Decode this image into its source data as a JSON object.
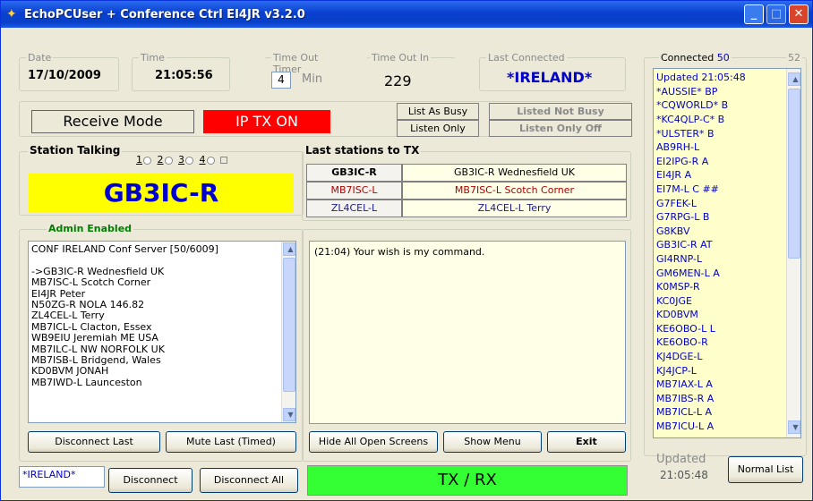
{
  "window": {
    "title": "EchoPCUser + Conference Ctrl   EI4JR  v3.2.0",
    "min_icon": "minimize-icon",
    "max_icon": "maximize-icon",
    "close_icon": "close-icon"
  },
  "date": {
    "label": "Date",
    "value": "17/10/2009"
  },
  "time": {
    "label": "Time",
    "value": "21:05:56"
  },
  "timeout": {
    "label": "Time Out Timer",
    "value": "4",
    "unit": "Min"
  },
  "timeoutin": {
    "label": "Time Out In",
    "value": "229"
  },
  "last_connected": {
    "label": "Last Connected",
    "value": "*IRELAND*"
  },
  "mode": {
    "receive": "Receive Mode",
    "iptx": "IP TX ON",
    "list_busy": "List As Busy",
    "listen_only": "Listen Only",
    "listed_not_busy": "Listed Not Busy",
    "listen_only_off": "Listen Only Off"
  },
  "station_talking": {
    "label": "Station Talking",
    "radios": [
      "1",
      "2",
      "3",
      "4"
    ],
    "value": "GB3IC-R"
  },
  "last_tx": {
    "label": "Last stations to TX",
    "rows": [
      {
        "call": "GB3IC-R",
        "desc": "GB3IC-R Wednesfield UK"
      },
      {
        "call": "MB7ISC-L",
        "desc": "MB7ISC-L Scotch Corner"
      },
      {
        "call": "ZL4CEL-L",
        "desc": "ZL4CEL-L Terry"
      }
    ]
  },
  "admin": {
    "label": "Admin Enabled",
    "items": [
      "CONF IRELAND Conf Server [50/6009]",
      "",
      "->GB3IC-R Wednesfield UK",
      "MB7ISC-L Scotch Corner",
      "EI4JR Peter",
      "N50ZG-R NOLA 146.82",
      "ZL4CEL-L Terry",
      "MB7ICL-L Clacton, Essex",
      "WB9EIU Jeremiah ME USA",
      "MB7ILC-L NW NORFOLK UK",
      "MB7ISB-L Bridgend, Wales",
      "KD0BVM JONAH",
      "MB7IWD-L Launceston"
    ]
  },
  "chat": {
    "text": "(21:04) Your wish is my command."
  },
  "buttons": {
    "disconnect_last": "Disconnect Last",
    "mute_last": "Mute Last (Timed)",
    "hide_all": "Hide All Open Screens",
    "show_menu": "Show Menu",
    "exit": "Exit",
    "disconnect": "Disconnect",
    "disconnect_all": "Disconnect All",
    "normal_list": "Normal List"
  },
  "connect_field": {
    "value": "*IRELAND*"
  },
  "txrx": {
    "label": "TX / RX"
  },
  "connected": {
    "label": "Connected",
    "count": "50",
    "max": "52",
    "items": [
      "Updated 21:05:48",
      "*AUSSIE* BP",
      "*CQWORLD* B",
      "*KC4QLP-C* B",
      "*ULSTER* B",
      "AB9RH-L",
      "EI2IPG-R A",
      "EI4JR A",
      "EI7M-L C ##",
      "G7FEK-L",
      "G7RPG-L B",
      "G8KBV",
      "GB3IC-R AT",
      "GI4RNP-L",
      "GM6MEN-L A",
      "K0MSP-R",
      "KC0JGE",
      "KD0BVM",
      "KE6OBO-L L",
      "KE6OBO-R",
      "KJ4DGE-L",
      "KJ4JCP-L",
      "MB7IAX-L A",
      "MB7IBS-R A",
      "MB7ICL-L A",
      "MB7ICU-L A"
    ],
    "updated_label": "Updated",
    "updated_time": "21:05:48"
  },
  "colors": {
    "yellow": "#ffff00",
    "red": "#ff0000",
    "green": "#33ff33",
    "list_yellow": "#ffffcc",
    "blue_text": "#0000cc"
  }
}
